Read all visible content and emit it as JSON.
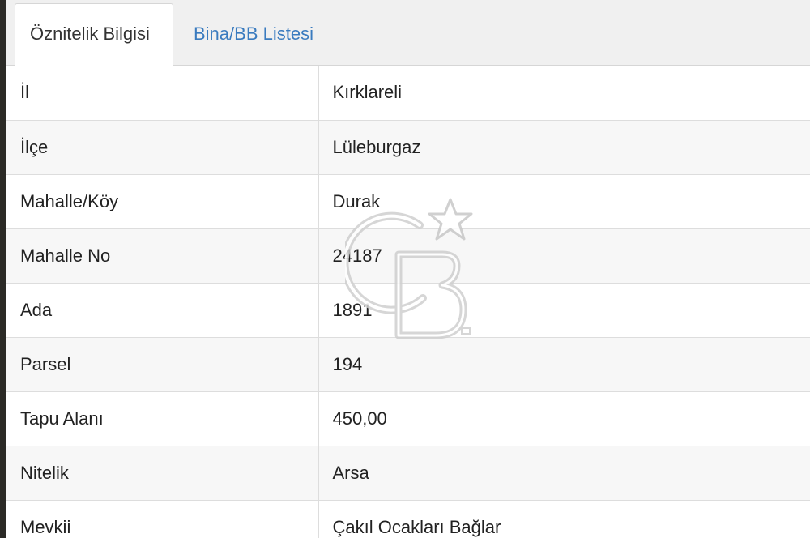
{
  "tabs": [
    {
      "label": "Öznitelik Bilgisi",
      "active": true
    },
    {
      "label": "Bina/BB Listesi",
      "active": false
    }
  ],
  "rows": [
    {
      "key": "İl",
      "value": "Kırklareli"
    },
    {
      "key": "İlçe",
      "value": "Lüleburgaz"
    },
    {
      "key": "Mahalle/Köy",
      "value": "Durak"
    },
    {
      "key": "Mahalle No",
      "value": "24187"
    },
    {
      "key": "Ada",
      "value": "1891"
    },
    {
      "key": "Parsel",
      "value": "194"
    },
    {
      "key": "Tapu Alanı",
      "value": "450,00"
    },
    {
      "key": "Nitelik",
      "value": "Arsa"
    },
    {
      "key": "Mevkii",
      "value": "Çakıl Ocakları Bağlar"
    }
  ],
  "watermark": {
    "text": "CB",
    "icon": "star-icon"
  },
  "colors": {
    "tab_link": "#3a7bbf",
    "row_alt": "#f7f7f7",
    "border": "#dddddd"
  }
}
